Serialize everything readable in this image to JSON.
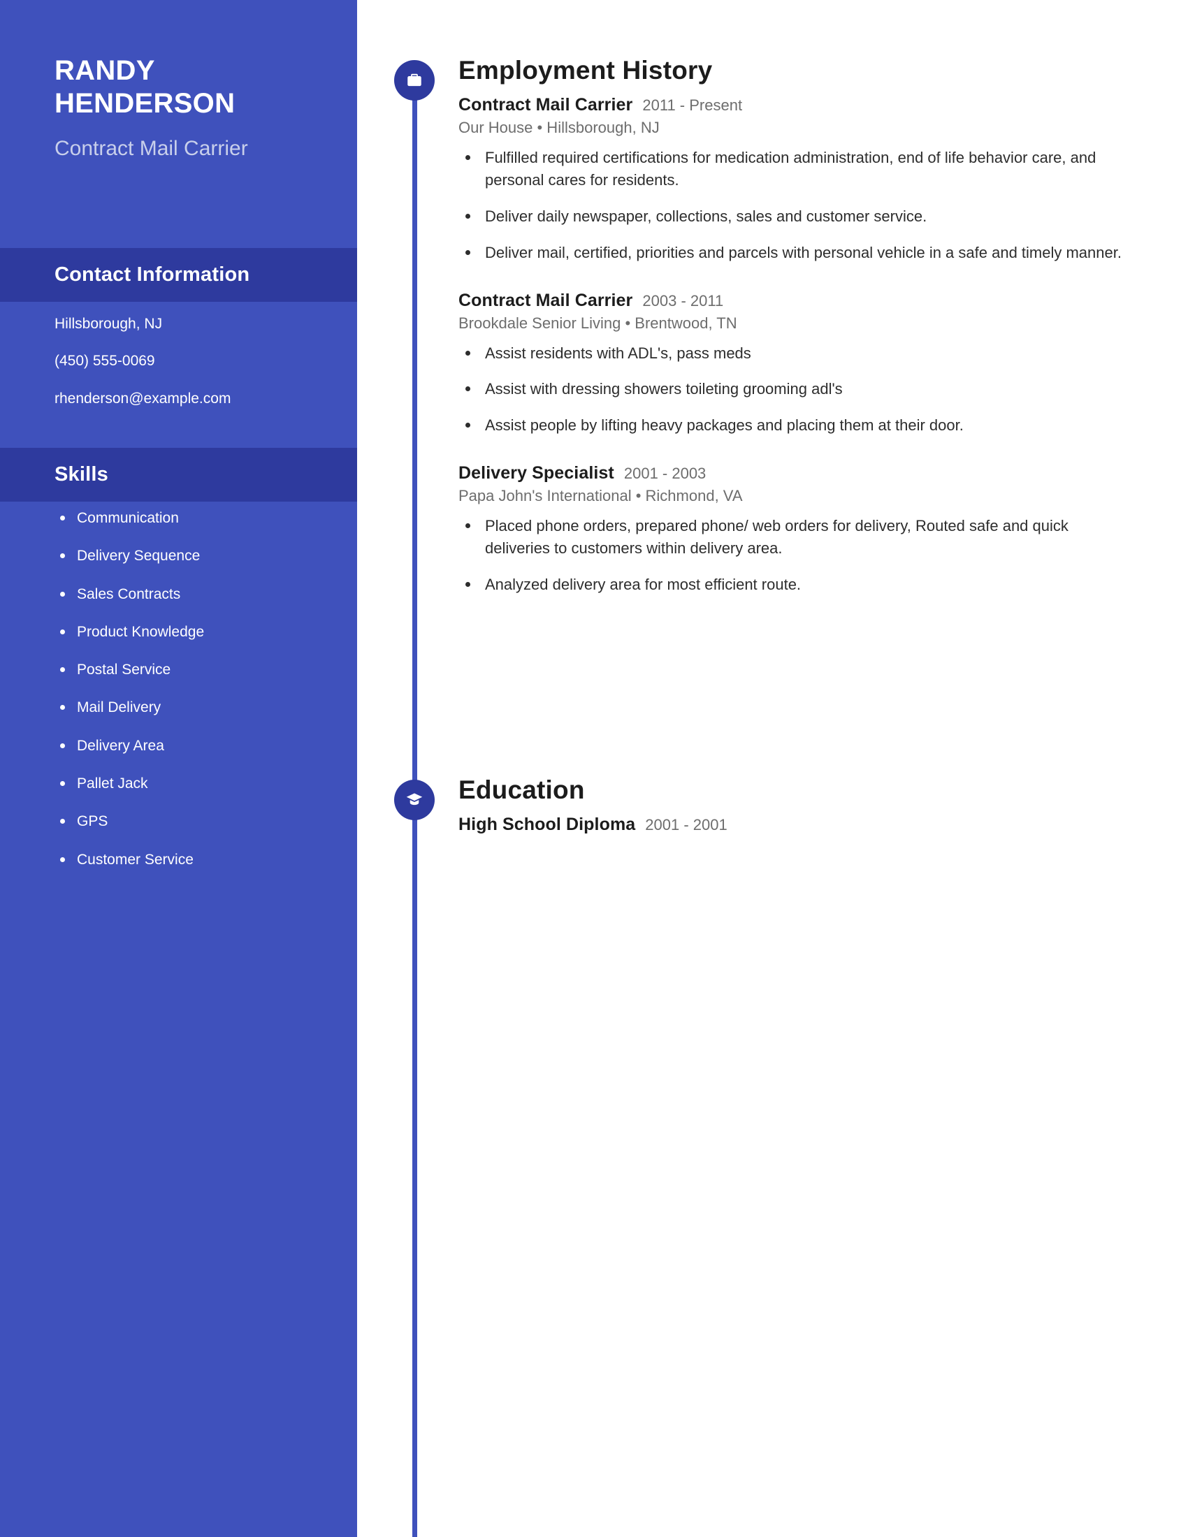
{
  "theme": {
    "sidebar_bg": "#3f51bc",
    "sidebar_band_bg": "#2e3a9e",
    "node_bg": "#2e3a9e",
    "timeline_color": "#3f51bc",
    "heading_color": "#1c1c1c",
    "muted_color": "#6d6d6d",
    "sidebar_subtitle_color": "#c8cfeb"
  },
  "sidebar": {
    "name": "RANDY HENDERSON",
    "job_title": "Contract Mail Carrier",
    "contact": {
      "heading": "Contact Information",
      "items": [
        "Hillsborough, NJ",
        "(450) 555-0069",
        "rhenderson@example.com"
      ]
    },
    "skills": {
      "heading": "Skills",
      "items": [
        "Communication",
        "Delivery Sequence",
        "Sales Contracts",
        "Product Knowledge",
        "Postal Service",
        "Mail Delivery",
        "Delivery Area",
        "Pallet Jack",
        "GPS",
        "Customer Service"
      ]
    }
  },
  "main": {
    "employment": {
      "heading": "Employment History",
      "icon": "briefcase-icon",
      "entries": [
        {
          "title": "Contract Mail Carrier",
          "dates": "2011 - Present",
          "company": "Our House",
          "separator": "•",
          "location": "Hillsborough, NJ",
          "meta": "Our House  •  Hillsborough, NJ",
          "bullets": [
            "Fulfilled required certifications for medication administration, end of life behavior care, and personal cares for residents.",
            "Deliver daily newspaper, collections, sales and customer service.",
            "Deliver mail, certified, priorities and parcels with personal vehicle in a safe and timely manner."
          ]
        },
        {
          "title": "Contract Mail Carrier",
          "dates": "2003 - 2011",
          "company": "Brookdale Senior Living",
          "separator": "•",
          "location": "Brentwood, TN",
          "meta": "Brookdale Senior Living  •  Brentwood, TN",
          "bullets": [
            "Assist residents with ADL's, pass meds",
            "Assist with dressing showers toileting grooming adl's",
            "Assist people by lifting heavy packages and placing them at their door."
          ]
        },
        {
          "title": "Delivery Specialist",
          "dates": "2001 - 2003",
          "company": "Papa John's International",
          "separator": "•",
          "location": "Richmond, VA",
          "meta": "Papa John's International  •  Richmond, VA",
          "bullets": [
            "Placed phone orders, prepared phone/ web orders for delivery, Routed safe and quick deliveries to customers within delivery area.",
            "Analyzed delivery area for most efficient route."
          ]
        }
      ]
    },
    "education": {
      "heading": "Education",
      "icon": "graduation-cap-icon",
      "entries": [
        {
          "title": "High School Diploma",
          "dates": "2001 - 2001"
        }
      ]
    }
  }
}
